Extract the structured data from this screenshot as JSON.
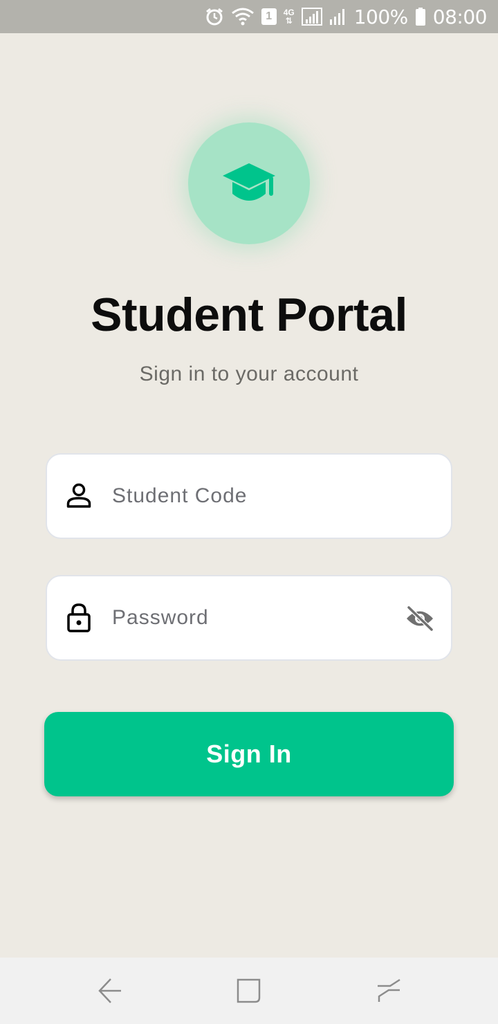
{
  "status_bar": {
    "sim_slot": "1",
    "network_type": "4G",
    "battery": "100%",
    "time": "08:00",
    "icons": [
      "alarm-icon",
      "wifi-icon",
      "sim-icon",
      "signal-icon",
      "battery-icon"
    ]
  },
  "logo": {
    "icon": "graduation-cap-icon",
    "accent_color": "#00c48c"
  },
  "title": "Student Portal",
  "subtitle": "Sign in to your account",
  "form": {
    "student_code": {
      "placeholder": "Student Code",
      "value": "",
      "icon": "person-icon"
    },
    "password": {
      "placeholder": "Password",
      "value": "",
      "icon": "lock-icon",
      "toggle_icon": "eye-off-icon"
    },
    "submit_label": "Sign In"
  },
  "nav_bar": {
    "icons": [
      "back-icon",
      "home-icon",
      "recent-apps-icon"
    ]
  },
  "colors": {
    "background": "#edeae3",
    "primary": "#00c48c",
    "logo_circle": "#a6e3c6"
  }
}
